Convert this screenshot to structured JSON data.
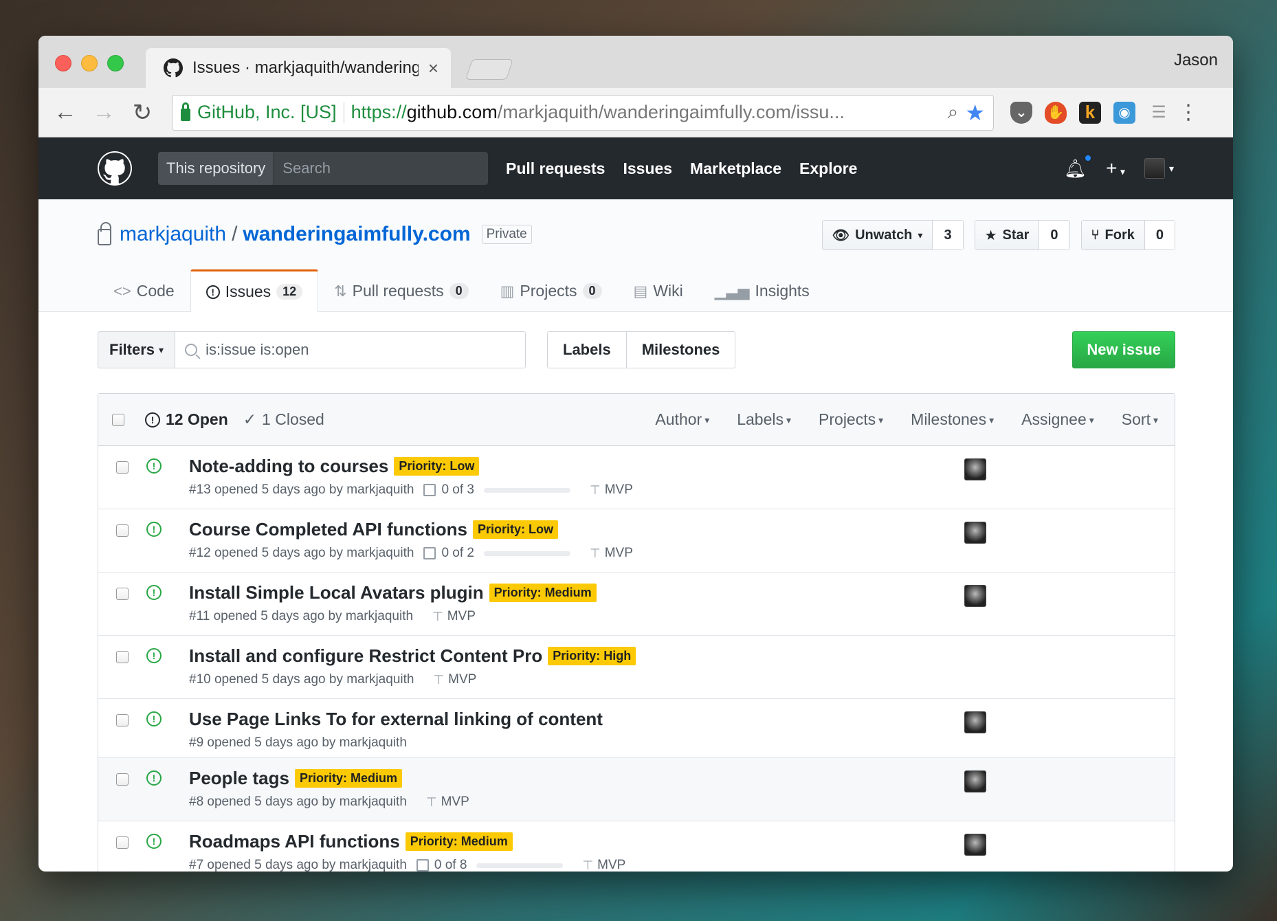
{
  "browser": {
    "tab_title": "Issues · markjaquith/wanderingaimfully.com",
    "tab_close": "×",
    "profile_name": "Jason",
    "secure_org": "GitHub, Inc. [US]",
    "url_scheme": "https://",
    "url_host": "github.com",
    "url_path": "/markjaquith/wanderingaimfully.com/issu...",
    "extensions": [
      "pocket-icon",
      "ublock-icon",
      "k-icon",
      "screenshot-icon",
      "list-icon"
    ],
    "ext_k_label": "k"
  },
  "gh_header": {
    "scope_label": "This repository",
    "search_placeholder": "Search",
    "nav": [
      "Pull requests",
      "Issues",
      "Marketplace",
      "Explore"
    ],
    "plus": "+"
  },
  "repo": {
    "owner": "markjaquith",
    "slash": "/",
    "name": "wanderingaimfully.com",
    "visibility": "Private",
    "watch_label": "Unwatch",
    "watch_count": "3",
    "star_label": "Star",
    "star_count": "0",
    "fork_label": "Fork",
    "fork_count": "0"
  },
  "reponav": {
    "code": "Code",
    "issues": "Issues",
    "issues_count": "12",
    "pulls": "Pull requests",
    "pulls_count": "0",
    "projects": "Projects",
    "projects_count": "0",
    "wiki": "Wiki",
    "insights": "Insights"
  },
  "subnav": {
    "filters_label": "Filters",
    "query": "is:issue is:open",
    "labels_label": "Labels",
    "milestones_label": "Milestones",
    "new_issue_label": "New issue"
  },
  "issues_header": {
    "open_label": "12 Open",
    "closed_label": "1 Closed",
    "filters": [
      "Author",
      "Labels",
      "Projects",
      "Milestones",
      "Assignee",
      "Sort"
    ]
  },
  "issues": [
    {
      "title": "Note-adding to courses",
      "label": "Priority: Low",
      "meta": "#13 opened 5 days ago by markjaquith",
      "tasks": "0 of 3",
      "milestone": "MVP"
    },
    {
      "title": "Course Completed API functions",
      "label": "Priority: Low",
      "meta": "#12 opened 5 days ago by markjaquith",
      "tasks": "0 of 2",
      "milestone": "MVP"
    },
    {
      "title": "Install Simple Local Avatars plugin",
      "label": "Priority: Medium",
      "meta": "#11 opened 5 days ago by markjaquith",
      "milestone": "MVP"
    },
    {
      "title": "Install and configure Restrict Content Pro",
      "label": "Priority: High",
      "meta": "#10 opened 5 days ago by markjaquith",
      "milestone": "MVP"
    },
    {
      "title": "Use Page Links To for external linking of content",
      "meta": "#9 opened 5 days ago by markjaquith"
    },
    {
      "title": "People tags",
      "label": "Priority: Medium",
      "meta": "#8 opened 5 days ago by markjaquith",
      "milestone": "MVP"
    },
    {
      "title": "Roadmaps API functions",
      "label": "Priority: Medium",
      "meta": "#7 opened 5 days ago by markjaquith",
      "tasks": "0 of 8",
      "milestone": "MVP"
    }
  ]
}
